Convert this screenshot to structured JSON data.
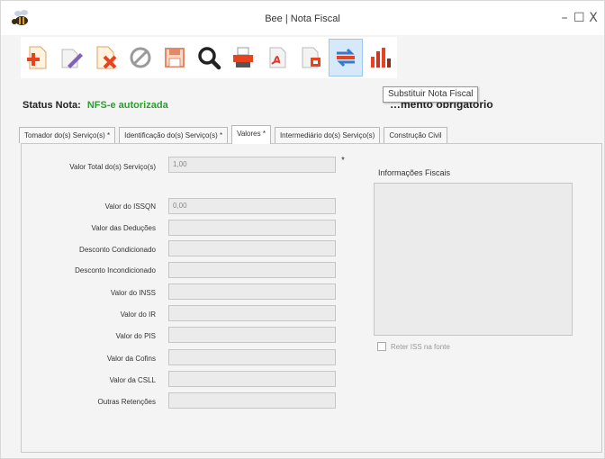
{
  "window": {
    "title": "Bee | Nota Fiscal",
    "controls": {
      "minimize": "–",
      "maximize": "☐",
      "close": "X"
    }
  },
  "toolbar": {
    "buttons": [
      {
        "icon": "new-document-plus-icon"
      },
      {
        "icon": "edit-pencil-icon"
      },
      {
        "icon": "delete-document-icon"
      },
      {
        "icon": "cancel-circle-icon"
      },
      {
        "icon": "save-floppy-icon"
      },
      {
        "icon": "search-magnifier-icon"
      },
      {
        "icon": "print-icon"
      },
      {
        "icon": "pdf-export-icon"
      },
      {
        "icon": "document-send-icon"
      },
      {
        "icon": "substitute-arrows-icon"
      },
      {
        "icon": "report-chart-icon"
      }
    ],
    "tooltip": "Substituir Nota Fiscal"
  },
  "status": {
    "label": "Status Nota:",
    "value": "NFS-e autorizada",
    "value_color": "#2e9e2e"
  },
  "notice": "…mento obrigatório",
  "tabs": [
    {
      "label": "Tomador do(s) Serviço(s) *",
      "active": false
    },
    {
      "label": "Identificação do(s) Serviço(s) *",
      "active": false
    },
    {
      "label": "Valores *",
      "active": true
    },
    {
      "label": "Intermediário do(s) Serviço(s)",
      "active": false
    },
    {
      "label": "Construção Civil",
      "active": false
    }
  ],
  "valores": {
    "total": {
      "label": "Valor Total do(s) Serviço(s)",
      "value": "1,00"
    },
    "required_mark": "*",
    "fields": [
      {
        "label": "Valor do ISSQN",
        "value": "0,00"
      },
      {
        "label": "Valor das Deduções",
        "value": ""
      },
      {
        "label": "Desconto Condicionado",
        "value": ""
      },
      {
        "label": "Desconto Incondicionado",
        "value": ""
      },
      {
        "label": "Valor do INSS",
        "value": ""
      },
      {
        "label": "Valor do IR",
        "value": ""
      },
      {
        "label": "Valor do PIS",
        "value": ""
      },
      {
        "label": "Valor da Cofins",
        "value": ""
      },
      {
        "label": "Valor da CSLL",
        "value": ""
      },
      {
        "label": "Outras Retenções",
        "value": ""
      }
    ],
    "info_title": "Informações Fiscais",
    "reter_iss_label": "Reter ISS na fonte"
  }
}
